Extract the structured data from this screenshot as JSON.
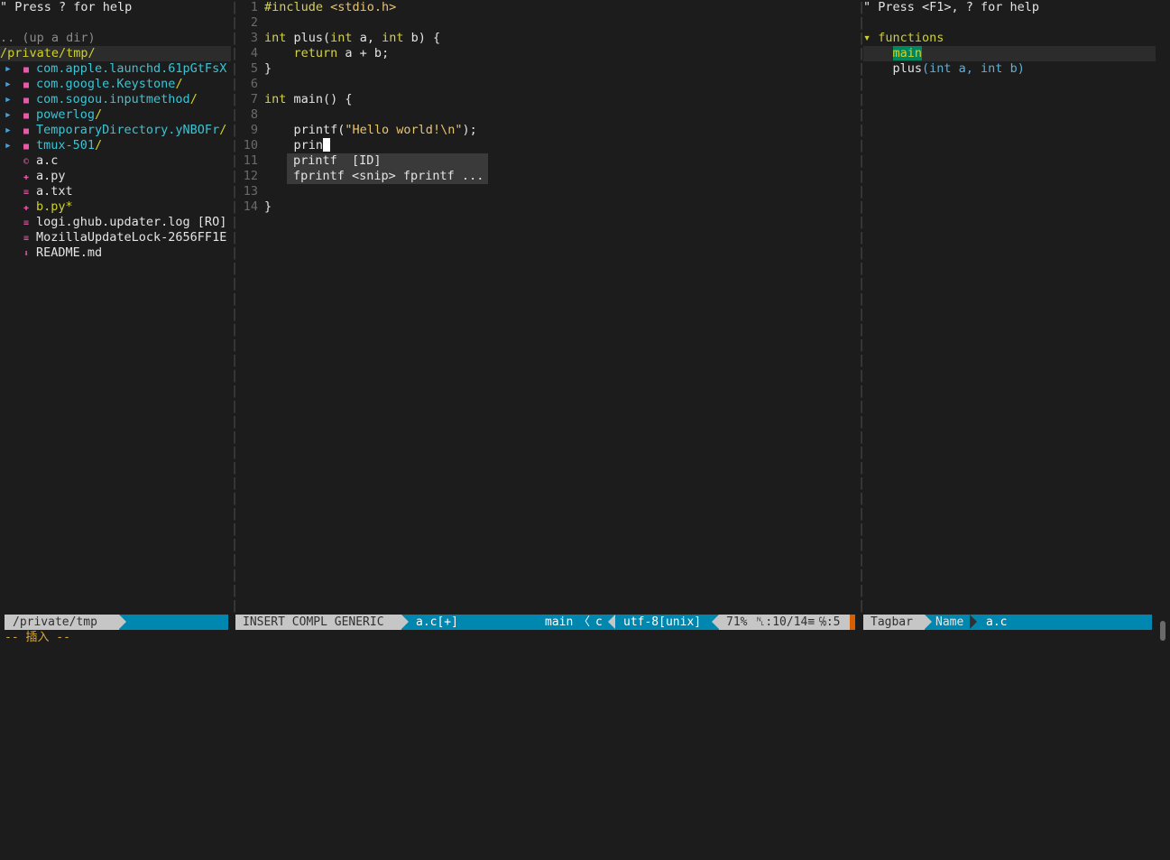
{
  "nerdtree": {
    "help": "\" Press ? for help",
    "up_dir": ".. (up a dir)",
    "cwd": "/private/tmp/",
    "entries": [
      {
        "kind": "dir",
        "name": "com.apple.launchd.61pGtFsX",
        "suffix": ""
      },
      {
        "kind": "dir",
        "name": "com.google.Keystone",
        "suffix": "/"
      },
      {
        "kind": "dir",
        "name": "com.sogou.inputmethod",
        "suffix": "/"
      },
      {
        "kind": "dir",
        "name": "powerlog",
        "suffix": "/"
      },
      {
        "kind": "dir",
        "name": "TemporaryDirectory.yNBOFr",
        "suffix": "/"
      },
      {
        "kind": "dir",
        "name": "tmux-501",
        "suffix": "/"
      },
      {
        "kind": "file",
        "icon": "c-file-icon",
        "glyph": "©",
        "color": "#e85aa8",
        "name": "a.c",
        "suffix": ""
      },
      {
        "kind": "file",
        "icon": "python-file-icon",
        "glyph": "✚",
        "color": "#e85aa8",
        "name": "a.py",
        "suffix": ""
      },
      {
        "kind": "file",
        "icon": "text-file-icon",
        "glyph": "≡",
        "color": "#e85aa8",
        "name": "a.txt",
        "suffix": ""
      },
      {
        "kind": "file",
        "icon": "python-file-icon",
        "glyph": "✚",
        "color": "#e85aa8",
        "name": "b.py*",
        "suffix": "",
        "modified": true
      },
      {
        "kind": "file",
        "icon": "log-file-icon",
        "glyph": "≡",
        "color": "#e85aa8",
        "name": "logi.ghub.updater.log [RO]",
        "suffix": ""
      },
      {
        "kind": "file",
        "icon": "lock-file-icon",
        "glyph": "≡",
        "color": "#e85aa8",
        "name": "MozillaUpdateLock-2656FF1E",
        "suffix": ""
      },
      {
        "kind": "file",
        "icon": "markdown-file-icon",
        "glyph": "⬇",
        "color": "#e85aa8",
        "name": "README.md",
        "suffix": ""
      }
    ]
  },
  "editor": {
    "lines": [
      {
        "n": "1",
        "t": [
          [
            "pp",
            "#include "
          ],
          [
            "str",
            "<stdio.h>"
          ]
        ]
      },
      {
        "n": "2",
        "t": []
      },
      {
        "n": "3",
        "t": [
          [
            "kw",
            "int"
          ],
          [
            "plain",
            " plus("
          ],
          [
            "kw",
            "int"
          ],
          [
            "plain",
            " a, "
          ],
          [
            "kw",
            "int"
          ],
          [
            "plain",
            " b) {"
          ]
        ]
      },
      {
        "n": "4",
        "t": [
          [
            "plain",
            "    "
          ],
          [
            "kw",
            "return"
          ],
          [
            "plain",
            " a + b;"
          ]
        ]
      },
      {
        "n": "5",
        "t": [
          [
            "plain",
            "}"
          ]
        ]
      },
      {
        "n": "6",
        "t": []
      },
      {
        "n": "7",
        "t": [
          [
            "kw",
            "int"
          ],
          [
            "plain",
            " main() {"
          ]
        ]
      },
      {
        "n": "8",
        "t": []
      },
      {
        "n": "9",
        "t": [
          [
            "plain",
            "    printf("
          ],
          [
            "str",
            "\"Hello world!\\n\""
          ],
          [
            "plain",
            ");"
          ]
        ]
      },
      {
        "n": "10",
        "t": [
          [
            "plain",
            "    prin"
          ]
        ],
        "cursor": true
      },
      {
        "n": "11",
        "t": []
      },
      {
        "n": "12",
        "t": []
      },
      {
        "n": "13",
        "t": []
      },
      {
        "n": "14",
        "t": [
          [
            "plain",
            "}"
          ]
        ]
      }
    ],
    "completion": [
      "printf  [ID]",
      "fprintf <snip> fprintf ..."
    ]
  },
  "tagbar": {
    "help": "\" Press <F1>, ? for help",
    "group_marker": "▾",
    "group": "functions",
    "items": [
      "main",
      "plus"
    ],
    "plus_sig": "(int a, int b)"
  },
  "status": {
    "left_path": "/private/tmp",
    "mode": "INSERT COMPL GENERIC",
    "file": "a.c[+]",
    "func": "main",
    "sep": "〈",
    "ft": "c",
    "enc": "utf-8[unix]",
    "pct": "71%",
    "pos": "␤:10/14≡",
    "col": "℅:5",
    "tb_label": "Tagbar",
    "tb_sort": "Name",
    "tb_file": "a.c"
  },
  "cmdline": "-- 插入 --",
  "colors": {
    "accent": "#0087af",
    "dir": "#3ac4d4",
    "highlight": "#cfd22a",
    "error_marker": "#d75f00"
  }
}
